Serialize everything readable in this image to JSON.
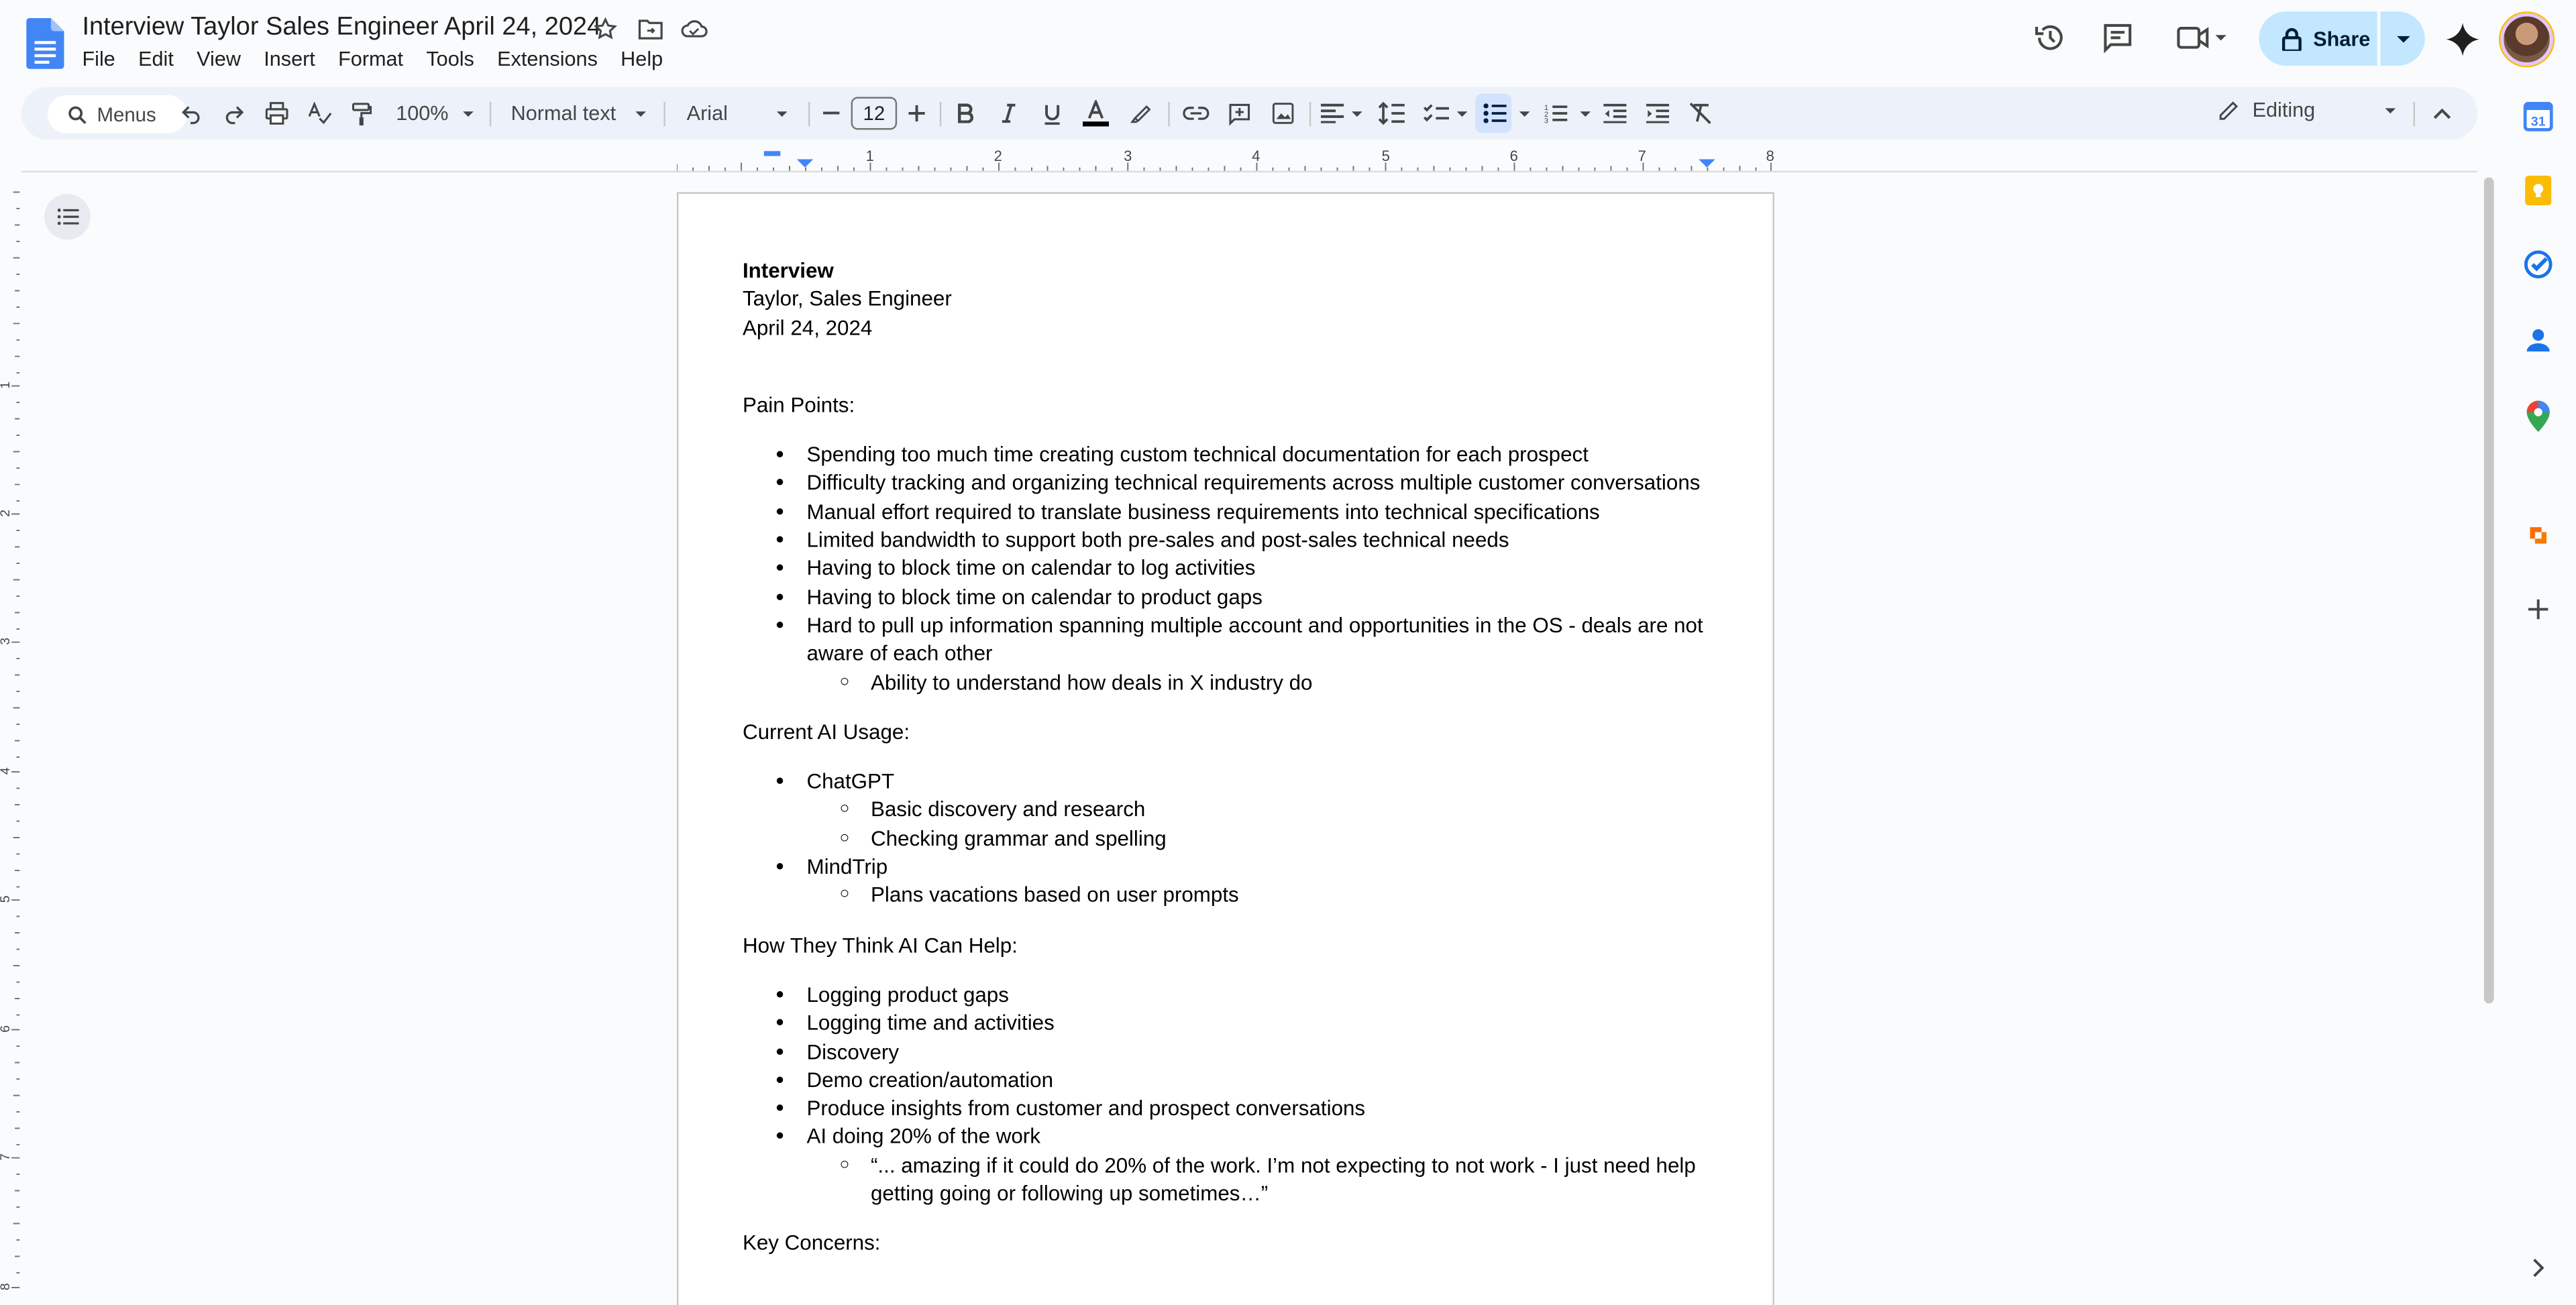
{
  "document": {
    "title": "Interview Taylor Sales Engineer April 24, 2024"
  },
  "menu": [
    "File",
    "Edit",
    "View",
    "Insert",
    "Format",
    "Tools",
    "Extensions",
    "Help"
  ],
  "header": {
    "share_label": "Share"
  },
  "toolbar": {
    "search_placeholder": "Menus",
    "zoom": "100%",
    "style": "Normal text",
    "font": "Arial",
    "font_size": "12",
    "mode": "Editing"
  },
  "ruler": [
    "1",
    "2",
    "3",
    "4",
    "5",
    "6",
    "7",
    "8"
  ],
  "vruler": [
    "1",
    "2",
    "3",
    "4",
    "5",
    "6",
    "7",
    "8"
  ],
  "content": {
    "heading": "Interview",
    "subtitle": "Taylor, Sales Engineer",
    "date": "April 24, 2024",
    "pain_title": "Pain Points:",
    "pain": [
      "Spending too much time creating custom technical documentation for each prospect",
      "Difficulty tracking and organizing technical requirements across multiple customer conversations",
      "Manual effort required to translate business requirements into technical specifications",
      "Limited bandwidth to support both pre-sales and post-sales technical needs",
      "Having to block time on calendar to log activities",
      "Having to block time on calendar to product gaps",
      "Hard to pull up information spanning multiple account and opportunities in the OS - deals are not aware of each other"
    ],
    "pain_sub": "Ability to understand how deals in X industry do",
    "ai_title": "Current AI Usage:",
    "ai_tool1": "ChatGPT",
    "ai_tool1_sub": [
      "Basic discovery and research",
      "Checking grammar and spelling"
    ],
    "ai_tool2": "MindTrip",
    "ai_tool2_sub": "Plans vacations based on user prompts",
    "help_title": "How They Think AI Can Help:",
    "help": [
      "Logging product gaps",
      "Logging time and activities",
      "Discovery",
      "Demo creation/automation",
      "Produce insights from customer and prospect conversations",
      "AI doing 20% of the work"
    ],
    "help_sub": "“... amazing if it could do 20% of the work. I’m not expecting to not work - I just need help getting going or following up sometimes…”",
    "concerns_title": "Key Concerns:"
  },
  "colors": {
    "accent": "#1a73e8",
    "share_bg": "#c2e7ff",
    "toolbar_bg": "#edf2fa",
    "page_bg": "#f9fbfd"
  }
}
